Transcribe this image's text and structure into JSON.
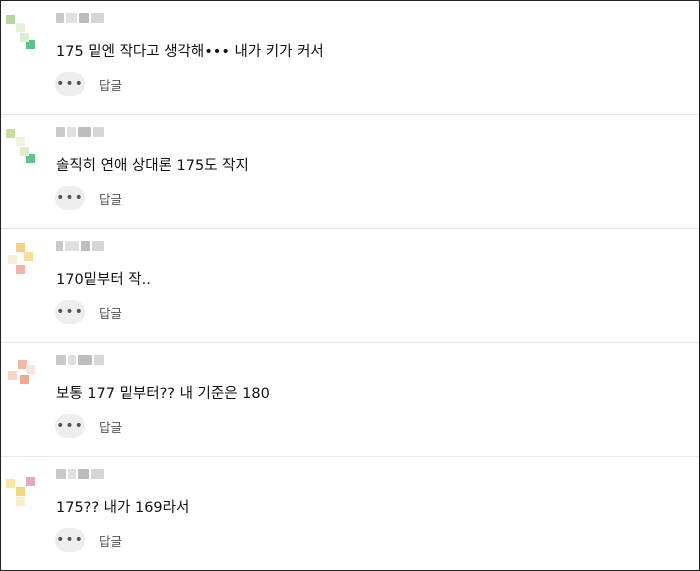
{
  "comments": [
    {
      "text": "175 밑엔 작다고 생각해••• 내가 키가 커서",
      "more_label": "•••",
      "reply_label": "답글",
      "avatar_colors": [
        "#b8d4a0",
        "#e7f2de",
        "#5fc08f",
        "#ddeecf"
      ]
    },
    {
      "text": "솔직히 연애 상대론 175도 작지",
      "more_label": "•••",
      "reply_label": "답글",
      "avatar_colors": [
        "#c7df9e",
        "#eef6e0",
        "#62c28f",
        "#dcecc8"
      ]
    },
    {
      "text": "170밑부터 작..",
      "more_label": "•••",
      "reply_label": "답글",
      "avatar_colors": [
        "#f2cf8b",
        "#f7df9a",
        "#f3b3a7",
        "#f8eed8"
      ]
    },
    {
      "text": "보통 177 밑부터?? 내 기준은 180",
      "more_label": "•••",
      "reply_label": "답글",
      "avatar_colors": [
        "#f5b8a6",
        "#f8d5c6",
        "#f1a892",
        "#fbe5dc"
      ]
    },
    {
      "text": "175?? 내가 169라서",
      "more_label": "•••",
      "reply_label": "답글",
      "avatar_colors": [
        "#f3d77c",
        "#fbe6a5",
        "#e7a6c7",
        "#f8efc8"
      ]
    }
  ]
}
